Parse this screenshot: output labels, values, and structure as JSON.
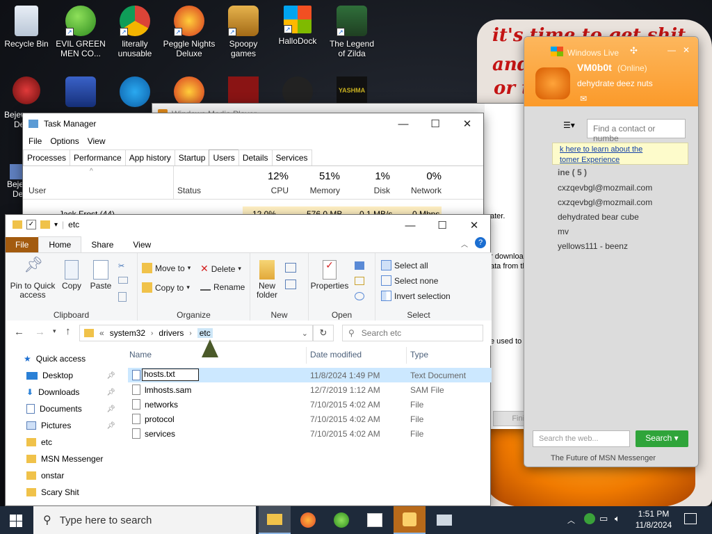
{
  "desktop": {
    "icons": [
      {
        "label": "Recycle Bin"
      },
      {
        "label": "EVIL GREEN MEN CO..."
      },
      {
        "label": "literally unusable"
      },
      {
        "label": "Peggle Nights Deluxe"
      },
      {
        "label": "Spoopy games"
      },
      {
        "label": "HalloDock"
      },
      {
        "label": "The Legend of Zilda"
      }
    ],
    "partial_labels": [
      "Bejewe",
      "De",
      "Beje",
      "De"
    ],
    "background_text": [
      "it's time to get shit",
      "and",
      "or t"
    ]
  },
  "wmp": {
    "title": "Windows Media Player",
    "finish": "Finish",
    "text1": "ater.",
    "text2": "r download",
    "text3": "ata from the",
    "text4": "e used to"
  },
  "task_manager": {
    "title": "Task Manager",
    "menu": [
      "File",
      "Options",
      "View"
    ],
    "tabs": [
      "Processes",
      "Performance",
      "App history",
      "Startup",
      "Users",
      "Details",
      "Services"
    ],
    "active_tab": "Users",
    "columns": {
      "user": "User",
      "status": "Status",
      "cpu": {
        "pct": "12%",
        "label": "CPU"
      },
      "memory": {
        "pct": "51%",
        "label": "Memory"
      },
      "disk": {
        "pct": "1%",
        "label": "Disk"
      },
      "network": {
        "pct": "0%",
        "label": "Network"
      }
    },
    "row": {
      "name": "Jack Frost (44)",
      "cpu": "12.0%",
      "memory": "576.0 MB",
      "disk": "0.1 MB/s",
      "network": "0 Mbps"
    }
  },
  "explorer": {
    "title": "etc",
    "ribbon_tabs": [
      "File",
      "Home",
      "Share",
      "View"
    ],
    "clipboard": {
      "pin": "Pin to Quick access",
      "copy": "Copy",
      "paste": "Paste",
      "group": "Clipboard"
    },
    "organize": {
      "move_to": "Move to",
      "copy_to": "Copy to",
      "delete": "Delete",
      "rename": "Rename",
      "group": "Organize"
    },
    "new": {
      "new_folder": "New folder",
      "group": "New"
    },
    "open": {
      "properties": "Properties",
      "group": "Open"
    },
    "select": {
      "select_all": "Select all",
      "select_none": "Select none",
      "invert": "Invert selection",
      "group": "Select"
    },
    "breadcrumb": [
      "system32",
      "drivers",
      "etc"
    ],
    "search_placeholder": "Search etc",
    "nav": [
      {
        "label": "Quick access"
      },
      {
        "label": "Desktop"
      },
      {
        "label": "Downloads"
      },
      {
        "label": "Documents"
      },
      {
        "label": "Pictures"
      },
      {
        "label": "etc"
      },
      {
        "label": "MSN Messenger"
      },
      {
        "label": "onstar"
      },
      {
        "label": "Scary Shit"
      }
    ],
    "headers": {
      "name": "Name",
      "date": "Date modified",
      "type": "Type"
    },
    "files": [
      {
        "name": "hosts.txt",
        "date": "11/8/2024 1:49 PM",
        "type": "Text Document"
      },
      {
        "name": "lmhosts.sam",
        "date": "12/7/2019 1:12 AM",
        "type": "SAM File"
      },
      {
        "name": "networks",
        "date": "7/10/2015 4:02 AM",
        "type": "File"
      },
      {
        "name": "protocol",
        "date": "7/10/2015 4:02 AM",
        "type": "File"
      },
      {
        "name": "services",
        "date": "7/10/2015 4:02 AM",
        "type": "File"
      }
    ]
  },
  "msn": {
    "title": "Windows Live",
    "user": "VM0b0t",
    "status": "(Online)",
    "personal_message": "dehydrate deez nuts",
    "find_placeholder": "Find a contact or numbe",
    "banner": [
      "k here to learn about the",
      "tomer Experience"
    ],
    "group": "ine ( 5 )",
    "contacts": [
      "cxzqevbgl@mozmail.com",
      "cxzqevbgl@mozmail.com",
      "dehydrated bear cube",
      "mv",
      "yellows111 - beenz"
    ],
    "search_placeholder": "Search the web...",
    "search_button": "Search",
    "footer": "The Future of MSN Messenger"
  },
  "taskbar": {
    "search_placeholder": "Type here to search",
    "time": "1:51 PM",
    "date": "11/8/2024"
  }
}
